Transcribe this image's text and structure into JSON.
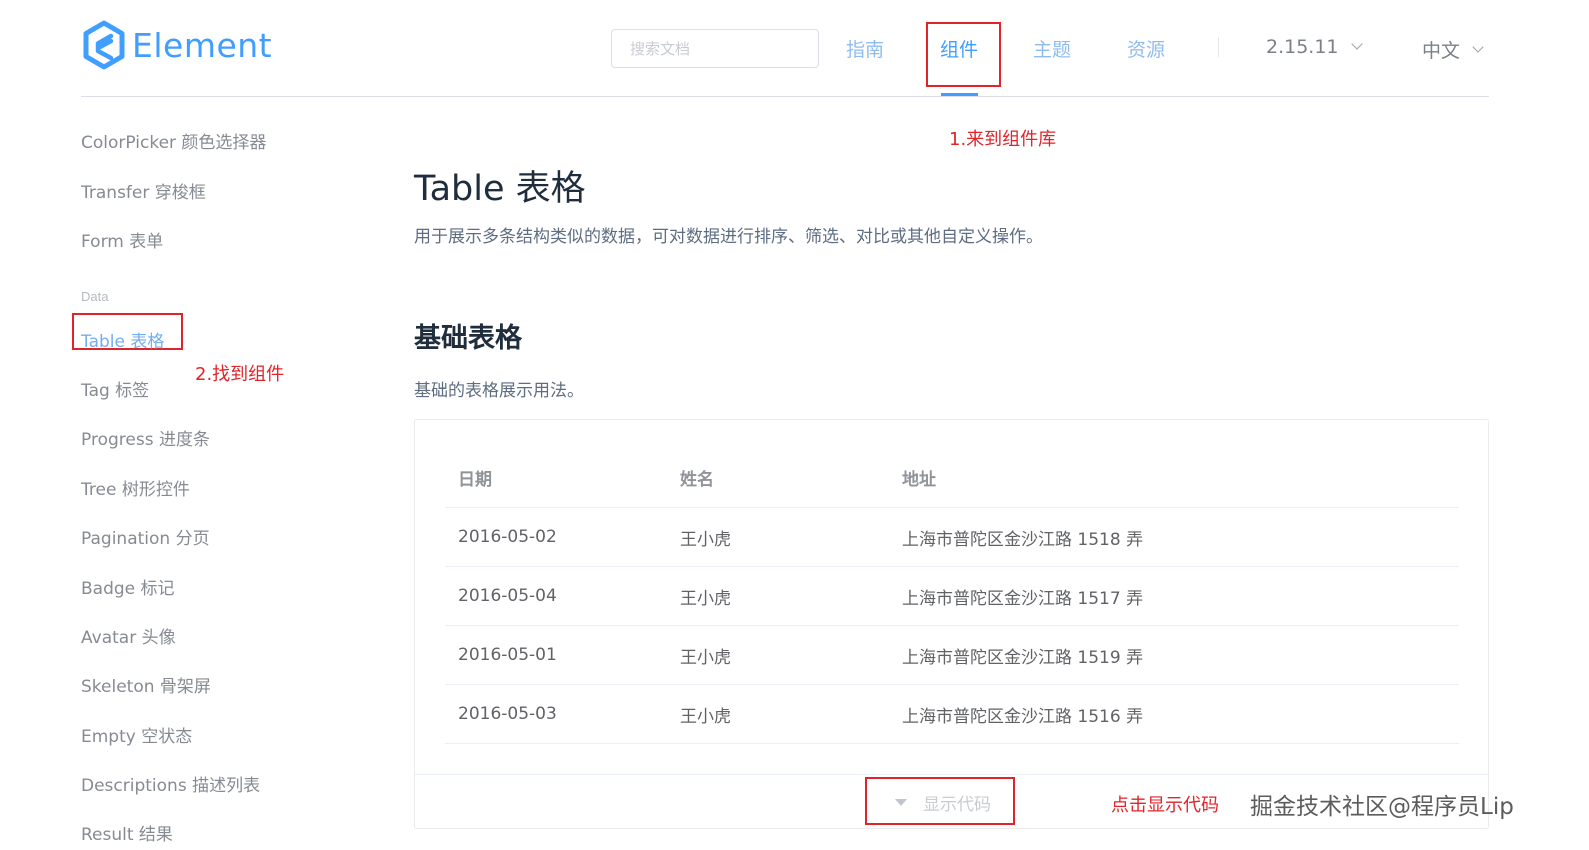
{
  "header": {
    "logo_text": "Element",
    "search_placeholder": "搜索文档",
    "nav": [
      {
        "label": "指南"
      },
      {
        "label": "组件"
      },
      {
        "label": "主题"
      },
      {
        "label": "资源"
      }
    ],
    "version": "2.15.11",
    "language": "中文"
  },
  "annotations": {
    "step1": "1.来到组件库",
    "step2": "2.找到组件",
    "step3": "点击显示代码"
  },
  "sidebar": {
    "group_data": "Data",
    "items": [
      {
        "label": "ColorPicker 颜色选择器"
      },
      {
        "label": "Transfer 穿梭框"
      },
      {
        "label": "Form 表单"
      },
      {
        "label": "Table 表格"
      },
      {
        "label": "Tag 标签"
      },
      {
        "label": "Progress 进度条"
      },
      {
        "label": "Tree 树形控件"
      },
      {
        "label": "Pagination 分页"
      },
      {
        "label": "Badge 标记"
      },
      {
        "label": "Avatar 头像"
      },
      {
        "label": "Skeleton 骨架屏"
      },
      {
        "label": "Empty 空状态"
      },
      {
        "label": "Descriptions 描述列表"
      },
      {
        "label": "Result 结果"
      }
    ]
  },
  "main": {
    "title": "Table 表格",
    "description": "用于展示多条结构类似的数据，可对数据进行排序、筛选、对比或其他自定义操作。",
    "section_title": "基础表格",
    "section_desc": "基础的表格展示用法。",
    "table": {
      "headers": [
        "日期",
        "姓名",
        "地址"
      ],
      "rows": [
        [
          "2016-05-02",
          "王小虎",
          "上海市普陀区金沙江路 1518 弄"
        ],
        [
          "2016-05-04",
          "王小虎",
          "上海市普陀区金沙江路 1517 弄"
        ],
        [
          "2016-05-01",
          "王小虎",
          "上海市普陀区金沙江路 1519 弄"
        ],
        [
          "2016-05-03",
          "王小虎",
          "上海市普陀区金沙江路 1516 弄"
        ]
      ]
    },
    "show_code": "显示代码"
  },
  "watermark": "掘金技术社区@程序员Lip",
  "colors": {
    "accent": "#409eff",
    "annotation": "#e0242a"
  }
}
